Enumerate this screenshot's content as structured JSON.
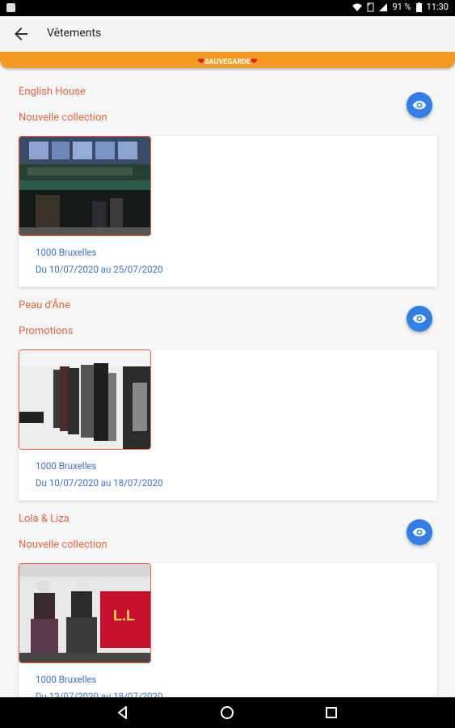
{
  "status": {
    "battery": "91 %",
    "time": "11:30"
  },
  "appbar": {
    "title": "Vêtements"
  },
  "banner": {
    "label": "SAUVEGARDE"
  },
  "entries": [
    {
      "name": "English House",
      "category": "Nouvelle collection",
      "location": "1000 Bruxelles",
      "dates": "Du 10/07/2020 au 25/07/2020"
    },
    {
      "name": "Peau d'Âne",
      "category": "Promotions",
      "location": "1000 Bruxelles",
      "dates": "Du 10/07/2020 au 18/07/2020"
    },
    {
      "name": "Lola & Liza",
      "category": "Nouvelle collection",
      "location": "1000 Bruxelles",
      "dates": "Du 13/07/2020 au 18/07/2020"
    }
  ],
  "colors": {
    "accent": "#f0613a",
    "banner": "#f59a20",
    "link": "#3a6fd8",
    "fab": "#2f7fe6"
  },
  "icons": {
    "back": "arrow-left-icon",
    "view": "eye-icon",
    "nav_back": "triangle-back-icon",
    "nav_home": "circle-home-icon",
    "nav_recents": "square-recents-icon"
  }
}
